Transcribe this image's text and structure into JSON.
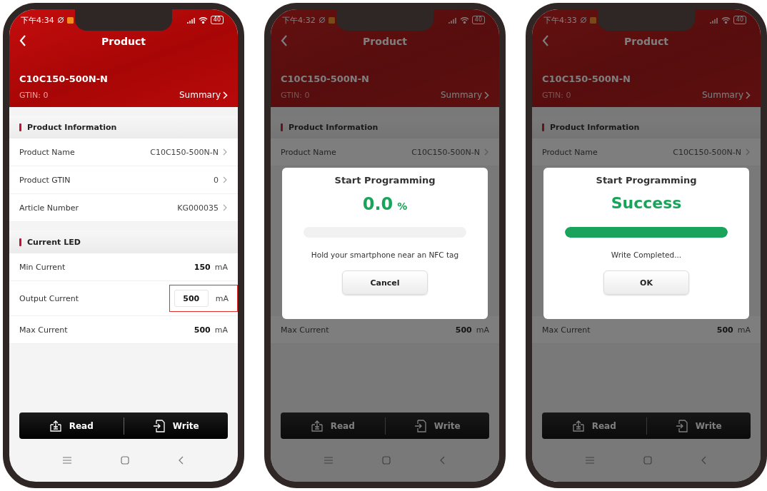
{
  "phones": [
    {
      "dimmed": false,
      "status": {
        "time": "下午4:34",
        "battery": "40"
      },
      "nav_title": "Product",
      "product": {
        "name": "C10C150-500N-N",
        "gtin": "GTIN: 0",
        "summary": "Summary"
      },
      "content": [
        {
          "kind": "section",
          "title": "Product Information"
        },
        {
          "kind": "link",
          "label": "Product Name",
          "value": "C10C150-500N-N"
        },
        {
          "kind": "link",
          "label": "Product GTIN",
          "value": "0"
        },
        {
          "kind": "link",
          "label": "Article Number",
          "value": "KG000035"
        },
        {
          "kind": "section",
          "title": "Current LED"
        },
        {
          "kind": "reading",
          "label": "Min Current",
          "value": "150",
          "unit": "mA"
        },
        {
          "kind": "input",
          "label": "Output Current",
          "value": "500",
          "unit": "mA",
          "highlighted": true
        },
        {
          "kind": "reading",
          "label": "Max Current",
          "value": "500",
          "unit": "mA"
        }
      ],
      "actions": [
        "Read",
        "Write"
      ]
    },
    {
      "dimmed": true,
      "status": {
        "time": "下午4:32",
        "battery": "40"
      },
      "nav_title": "Product",
      "product": {
        "name": "C10C150-500N-N",
        "gtin": "GTIN: 0",
        "summary": "Summary"
      },
      "content": [
        {
          "kind": "section",
          "title": "Product Information"
        },
        {
          "kind": "link",
          "label": "Product Name",
          "value": "C10C150-500N-N"
        },
        {
          "kind": "dialog",
          "title": "Start Programming",
          "value": "0.0",
          "unit": "%",
          "level": 0,
          "message": "Hold your smartphone near an NFC tag",
          "button": "Cancel"
        },
        {
          "kind": "reading",
          "label": "Max Current",
          "value": "500",
          "unit": "mA"
        }
      ],
      "actions": [
        "Read",
        "Write"
      ]
    },
    {
      "dimmed": true,
      "status": {
        "time": "下午4:33",
        "battery": "40"
      },
      "nav_title": "Product",
      "product": {
        "name": "C10C150-500N-N",
        "gtin": "GTIN: 0",
        "summary": "Summary"
      },
      "content": [
        {
          "kind": "section",
          "title": "Product Information"
        },
        {
          "kind": "link",
          "label": "Product Name",
          "value": "C10C150-500N-N"
        },
        {
          "kind": "dialog",
          "title": "Start Programming",
          "value": "Success",
          "level": 1,
          "message": "Write Completed...",
          "button": "OK"
        },
        {
          "kind": "reading",
          "label": "Max Current",
          "value": "500",
          "unit": "mA"
        }
      ],
      "actions": [
        "Read",
        "Write"
      ]
    }
  ]
}
